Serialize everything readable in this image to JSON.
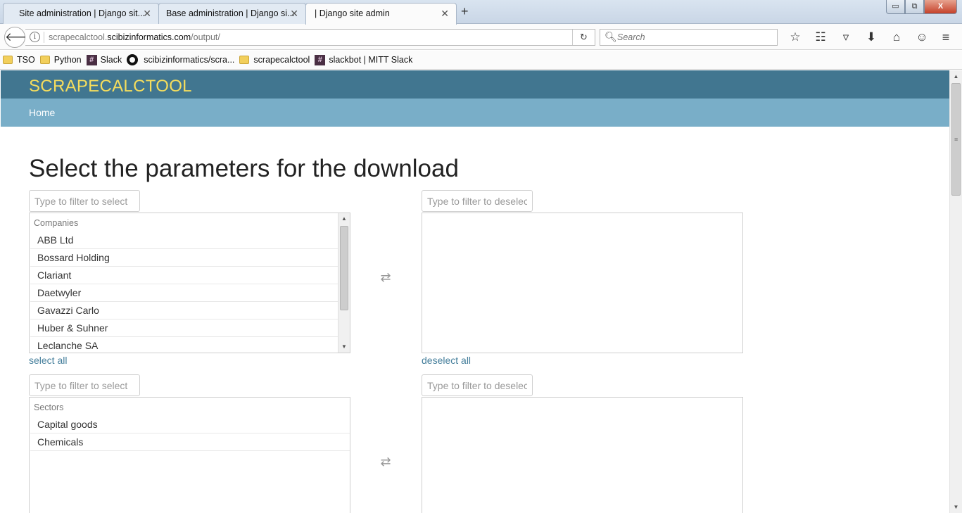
{
  "browser": {
    "tabs": [
      {
        "title": "Site administration | Django sit...",
        "active": false
      },
      {
        "title": "Base administration | Django si...",
        "active": false
      },
      {
        "title": "| Django site admin",
        "active": true
      }
    ],
    "new_tab": "+",
    "close_glyph": "✕",
    "url": {
      "prefix": "scrapecalctool.",
      "domain": "scibizinformatics.com",
      "path": "/output/"
    },
    "search_placeholder": "Search",
    "window_buttons": {
      "minimize": "▭",
      "restore": "⧉",
      "close": "X"
    },
    "toolbar_icons": [
      "star-icon",
      "reading-list-icon",
      "pocket-icon",
      "download-icon",
      "home-icon",
      "hello-icon"
    ]
  },
  "bookmarks": [
    {
      "label": "TSO",
      "icon": "folder-icon"
    },
    {
      "label": "Python",
      "icon": "folder-icon"
    },
    {
      "label": "Slack",
      "icon": "slack-icon"
    },
    {
      "label": "scibizinformatics/scra...",
      "icon": "github-icon"
    },
    {
      "label": "scrapecalctool",
      "icon": "folder-icon"
    },
    {
      "label": "slackbot | MITT Slack",
      "icon": "slack-icon"
    }
  ],
  "site": {
    "title": "SCRAPECALCTOOL",
    "nav_home": "Home",
    "header_color": "#417690",
    "nav_color": "#79aec8",
    "title_color": "#f5dd5d"
  },
  "main": {
    "heading": "Select the parameters for the download",
    "companies": {
      "filter_select_placeholder": "Type to filter to select",
      "filter_deselect_placeholder": "Type to filter to deselect",
      "group": "Companies",
      "options": [
        "ABB Ltd",
        "Bossard Holding",
        "Clariant",
        "Daetwyler",
        "Gavazzi Carlo",
        "Huber & Suhner",
        "Leclanche SA"
      ],
      "select_all": "select all",
      "deselect_all": "deselect all"
    },
    "sectors": {
      "filter_select_placeholder": "Type to filter to select",
      "filter_deselect_placeholder": "Type to filter to deselect",
      "group": "Sectors",
      "options": [
        "Capital goods",
        "Chemicals"
      ]
    }
  }
}
